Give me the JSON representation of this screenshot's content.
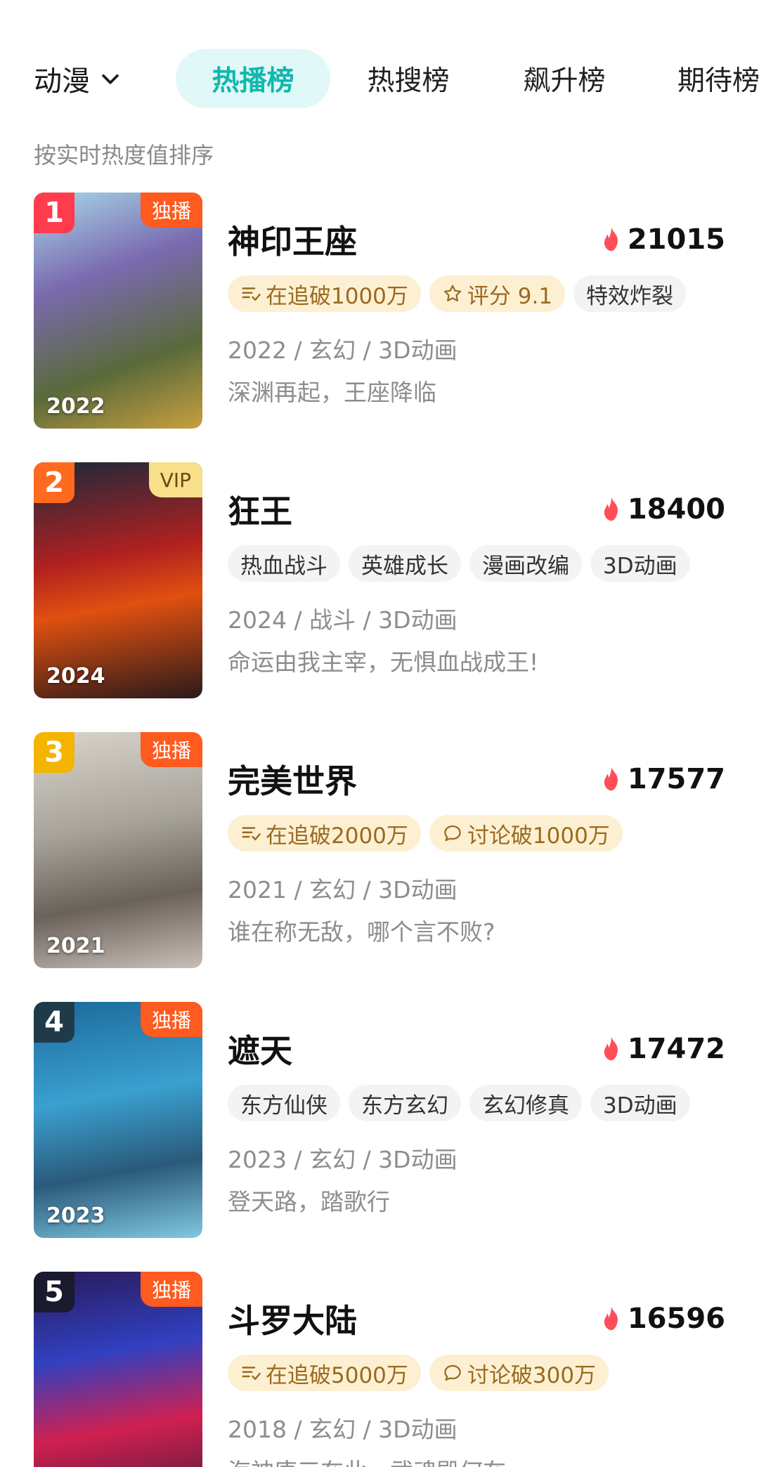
{
  "header": {
    "category": "动漫",
    "tabs": [
      {
        "label": "热播榜",
        "active": true
      },
      {
        "label": "热搜榜",
        "active": false
      },
      {
        "label": "飙升榜",
        "active": false
      },
      {
        "label": "期待榜",
        "active": false
      }
    ],
    "subtitle": "按实时热度值排序"
  },
  "colors": {
    "accent": "#10b8ad",
    "exclusive_badge": "#ff5a1f",
    "vip_badge": "#f8df8a",
    "heat_flame": "#ff4d5a",
    "gold_tag_bg": "#fdf0d2"
  },
  "items": [
    {
      "rank": "1",
      "rank_color": "#ff3b4e",
      "badge": "独播",
      "badge_type": "exclusive",
      "poster_year": "2022",
      "title": "神印王座",
      "heat": "21015",
      "tags": [
        {
          "icon": "list-check-icon",
          "text": "在追破1000万",
          "style": "gold"
        },
        {
          "icon": "star-outline-icon",
          "text": "评分 9.1",
          "style": "gold"
        },
        {
          "icon": "",
          "text": "特效炸裂",
          "style": "plain"
        }
      ],
      "meta": "2022 / 玄幻 / 3D动画",
      "desc": "深渊再起，王座降临"
    },
    {
      "rank": "2",
      "rank_color": "#ff6a1f",
      "badge": "VIP",
      "badge_type": "vip",
      "poster_year": "2024",
      "title": "狂王",
      "heat": "18400",
      "tags": [
        {
          "icon": "",
          "text": "热血战斗",
          "style": "plain"
        },
        {
          "icon": "",
          "text": "英雄成长",
          "style": "plain"
        },
        {
          "icon": "",
          "text": "漫画改编",
          "style": "plain"
        },
        {
          "icon": "",
          "text": "3D动画",
          "style": "plain"
        }
      ],
      "meta": "2024 / 战斗 / 3D动画",
      "desc": "命运由我主宰，无惧血战成王!"
    },
    {
      "rank": "3",
      "rank_color": "#f5b400",
      "badge": "独播",
      "badge_type": "exclusive",
      "poster_year": "2021",
      "title": "完美世界",
      "heat": "17577",
      "tags": [
        {
          "icon": "list-check-icon",
          "text": "在追破2000万",
          "style": "gold"
        },
        {
          "icon": "chat-bubble-icon",
          "text": "讨论破1000万",
          "style": "gold"
        }
      ],
      "meta": "2021 / 玄幻 / 3D动画",
      "desc": "谁在称无敌，哪个言不败?"
    },
    {
      "rank": "4",
      "rank_color": "#1f3b4a",
      "badge": "独播",
      "badge_type": "exclusive",
      "poster_year": "2023",
      "title": "遮天",
      "heat": "17472",
      "tags": [
        {
          "icon": "",
          "text": "东方仙侠",
          "style": "plain"
        },
        {
          "icon": "",
          "text": "东方玄幻",
          "style": "plain"
        },
        {
          "icon": "",
          "text": "玄幻修真",
          "style": "plain"
        },
        {
          "icon": "",
          "text": "3D动画",
          "style": "plain"
        }
      ],
      "meta": "2023 / 玄幻 / 3D动画",
      "desc": "登天路，踏歌行"
    },
    {
      "rank": "5",
      "rank_color": "#1a1a2e",
      "badge": "独播",
      "badge_type": "exclusive",
      "poster_year": "",
      "title": "斗罗大陆",
      "heat": "16596",
      "tags": [
        {
          "icon": "list-check-icon",
          "text": "在追破5000万",
          "style": "gold"
        },
        {
          "icon": "chat-bubble-icon",
          "text": "讨论破300万",
          "style": "gold"
        }
      ],
      "meta": "2018 / 玄幻 / 3D动画",
      "desc": "海神唐三在此，武魂殿何在"
    }
  ]
}
